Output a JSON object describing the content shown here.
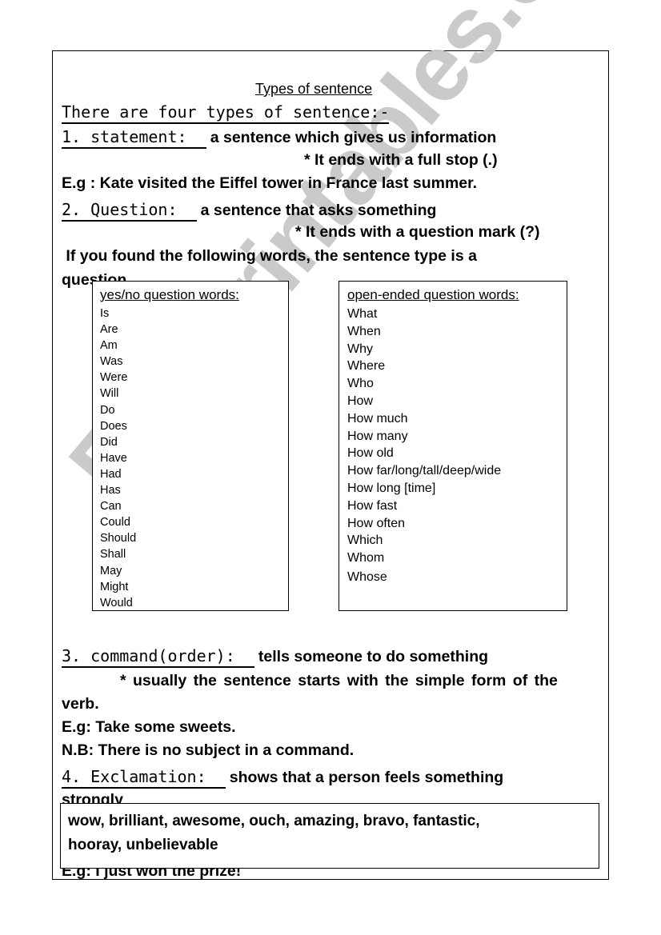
{
  "watermark": "ESLprintables.com",
  "title": "Types of sentence",
  "intro": "There are four types of sentence:-",
  "statement": {
    "heading": "1. statement:  ",
    "definition": "a sentence which gives us information",
    "note": "* It ends with a full stop (.)",
    "example": "E.g : Kate visited the Eiffel tower in France last summer."
  },
  "question": {
    "heading": "2. Question:  ",
    "definition": "a sentence that asks something",
    "note": "* It ends with a question mark (?)",
    "hint_line1": " If you found the following words, the sentence type is a",
    "hint_line2": "question",
    "yes_no_box": {
      "title": "yes/no question words:",
      "words": [
        "Is",
        "Are",
        "Am",
        "Was",
        "Were",
        "Will",
        "Do",
        "Does",
        "Did",
        "Have",
        "Had",
        "Has",
        "Can",
        "Could",
        "Should",
        "Shall",
        "May",
        "Might",
        "Would"
      ]
    },
    "open_ended_box": {
      "title": "open-ended question words:",
      "words": [
        "What",
        "When",
        "Why",
        "Where",
        "Who",
        "How",
        "How much",
        "How many",
        "How old",
        "How far/long/tall/deep/wide",
        "How long [time]",
        "How fast",
        "How often",
        "Which",
        "Whom",
        "Whose"
      ]
    }
  },
  "command": {
    "heading": "3. command(order):  ",
    "definition": "tells someone to do something",
    "note_line1": "* usually the sentence starts with the simple form of the",
    "note_line2": "verb.",
    "example": "E.g: Take some sweets.",
    "nb": "N.B: There is no subject in a command."
  },
  "exclamation": {
    "heading": "4. Exclamation:  ",
    "definition": "shows that a person feels something",
    "definition_line2": "strongly",
    "words_line1": "wow, brilliant, awesome, ouch, amazing, bravo, fantastic,",
    "words_line2": "hooray, unbelievable",
    "example": "E.g: I just won the prize!"
  }
}
